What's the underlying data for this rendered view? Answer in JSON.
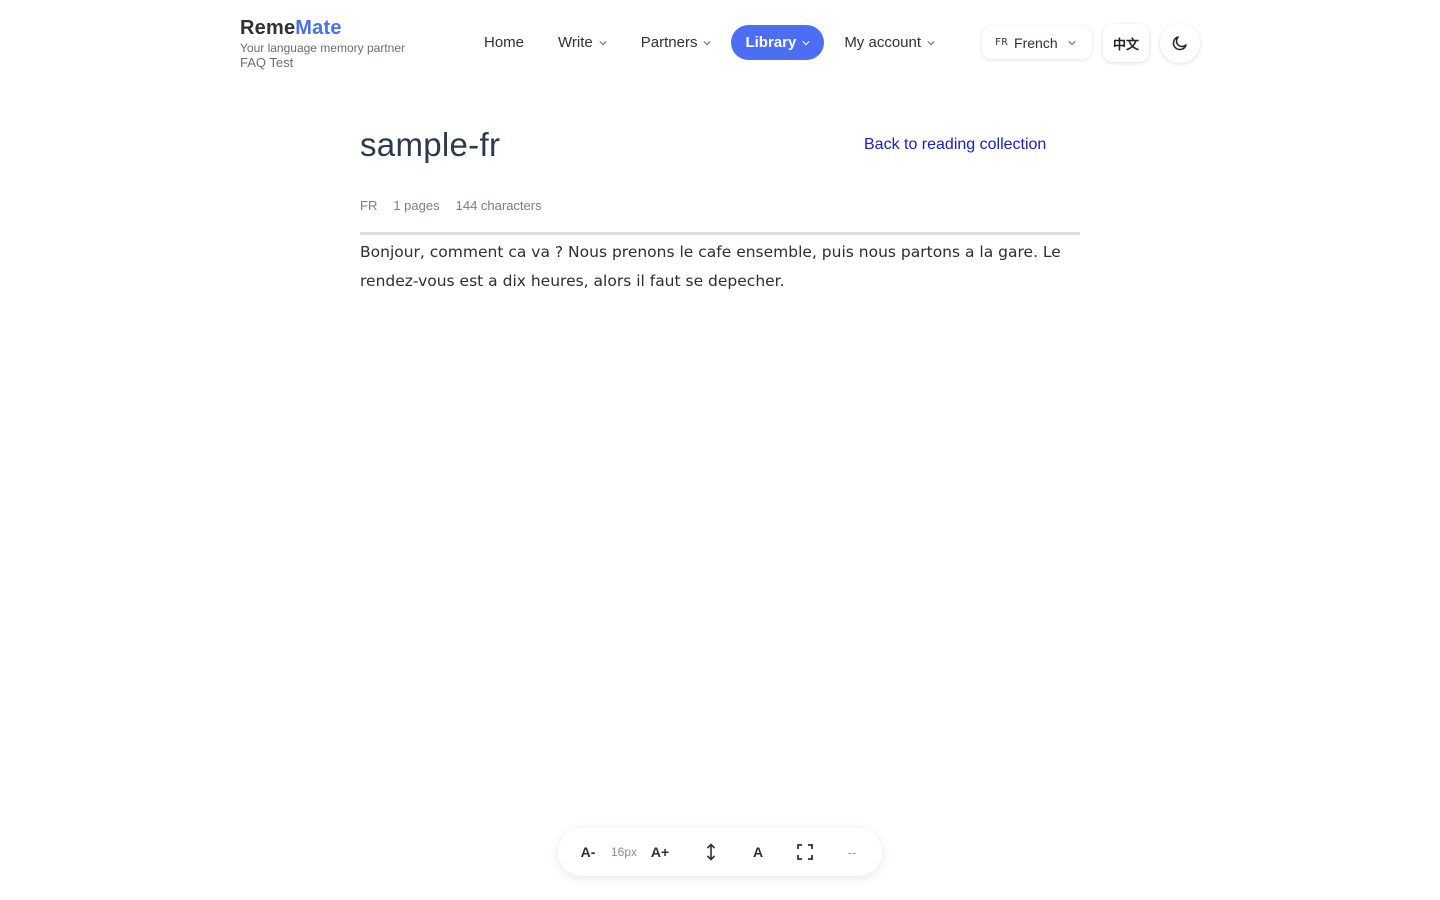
{
  "brand": {
    "name_part1": "Reme",
    "name_part2": "Mate",
    "tagline": "Your language memory partner",
    "subtitle": "FAQ Test",
    "accent_color": "#4a72e8"
  },
  "nav": {
    "items": [
      {
        "label": "Home",
        "has_dropdown": false,
        "active": false
      },
      {
        "label": "Write",
        "has_dropdown": true,
        "active": false
      },
      {
        "label": "Partners",
        "has_dropdown": true,
        "active": false
      },
      {
        "label": "Library",
        "has_dropdown": true,
        "active": true
      },
      {
        "label": "My account",
        "has_dropdown": true,
        "active": false
      }
    ],
    "active_color": "#4b6ef5"
  },
  "language_select": {
    "code": "FR",
    "label": "French"
  },
  "ui_language_button": "中文",
  "theme_toggle_icon": "moon-icon",
  "document": {
    "title": "sample-fr",
    "back_link": "Back to reading collection",
    "meta": {
      "language": "FR",
      "pages": "1 pages",
      "characters": "144 characters"
    },
    "content": "Bonjour, comment ca va ? Nous prenons le cafe ensemble, puis nous partons a la gare. Le rendez-vous est a dix heures, alors il faut se depecher."
  },
  "toolbar": {
    "decrease_label": "A-",
    "font_size": "16px",
    "increase_label": "A+",
    "line_height_icon": "vertical-arrows-icon",
    "font_label": "A",
    "fullscreen_icon": "fullscreen-icon",
    "extra_label": "--"
  }
}
